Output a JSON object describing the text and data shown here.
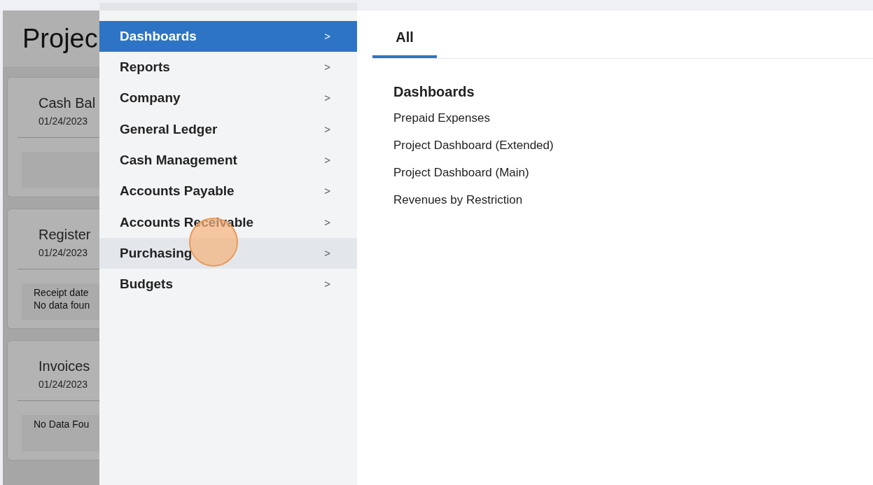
{
  "page": {
    "title": "Projec"
  },
  "cards": [
    {
      "title": "Cash Bal",
      "date": "01/24/2023"
    },
    {
      "title": "Register",
      "date": "01/24/2023",
      "lines": [
        "Receipt date",
        "No data foun"
      ]
    },
    {
      "title": "Invoices",
      "date": "01/24/2023",
      "lines": [
        "No Data Fou"
      ]
    }
  ],
  "menu": {
    "items": [
      {
        "label": "Dashboards",
        "selected": true,
        "hovered": false
      },
      {
        "label": "Reports",
        "selected": false,
        "hovered": false
      },
      {
        "label": "Company",
        "selected": false,
        "hovered": false
      },
      {
        "label": "General Ledger",
        "selected": false,
        "hovered": false
      },
      {
        "label": "Cash Management",
        "selected": false,
        "hovered": false
      },
      {
        "label": "Accounts Payable",
        "selected": false,
        "hovered": false
      },
      {
        "label": "Accounts Receivable",
        "selected": false,
        "hovered": false
      },
      {
        "label": "Purchasing",
        "selected": false,
        "hovered": true
      },
      {
        "label": "Budgets",
        "selected": false,
        "hovered": false
      }
    ],
    "chevron": ">"
  },
  "tabs": [
    {
      "label": "All",
      "selected": true
    }
  ],
  "section": {
    "heading": "Dashboards",
    "links": [
      "Prepaid Expenses",
      "Project Dashboard (Extended)",
      "Project Dashboard (Main)",
      "Revenues by Restriction"
    ]
  }
}
